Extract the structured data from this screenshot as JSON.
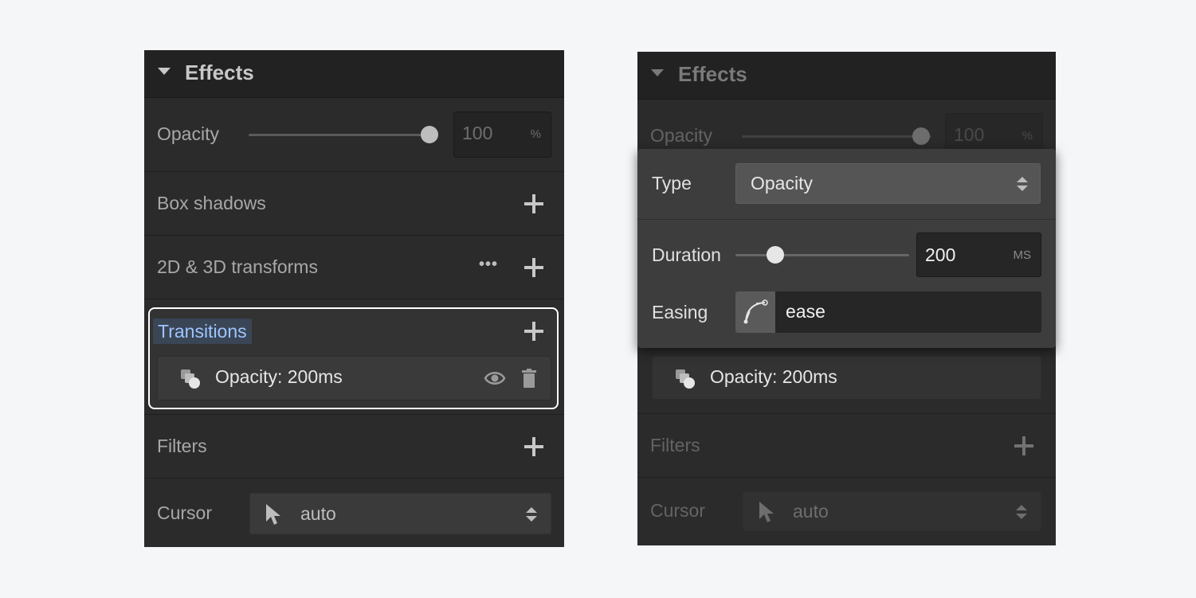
{
  "left": {
    "header": {
      "title": "Effects"
    },
    "opacity": {
      "label": "Opacity",
      "value": "100",
      "unit": "%",
      "level": 1.0
    },
    "box_shadows": {
      "label": "Box shadows"
    },
    "transforms": {
      "label": "2D & 3D transforms",
      "more": "•••"
    },
    "transitions": {
      "label": "Transitions",
      "item": {
        "label": "Opacity: 200ms"
      }
    },
    "filters": {
      "label": "Filters"
    },
    "cursor": {
      "label": "Cursor",
      "value": "auto"
    }
  },
  "right": {
    "header": {
      "title": "Effects"
    },
    "opacity": {
      "label": "Opacity",
      "value": "100",
      "unit": "%"
    },
    "popover": {
      "type_label": "Type",
      "type_value": "Opacity",
      "duration_label": "Duration",
      "duration_value": "200",
      "duration_unit": "MS",
      "duration_level": 0.2,
      "easing_label": "Easing",
      "easing_value": "ease"
    },
    "transition_item": {
      "label": "Opacity: 200ms"
    },
    "filters": {
      "label": "Filters"
    },
    "cursor": {
      "label": "Cursor",
      "value": "auto"
    }
  },
  "colors": {
    "panel_bg": "#2b2b2b",
    "header_bg": "#222222",
    "highlight_text": "#9ec5ff",
    "highlight_bg": "#3a4556",
    "outline": "#ffffff"
  }
}
